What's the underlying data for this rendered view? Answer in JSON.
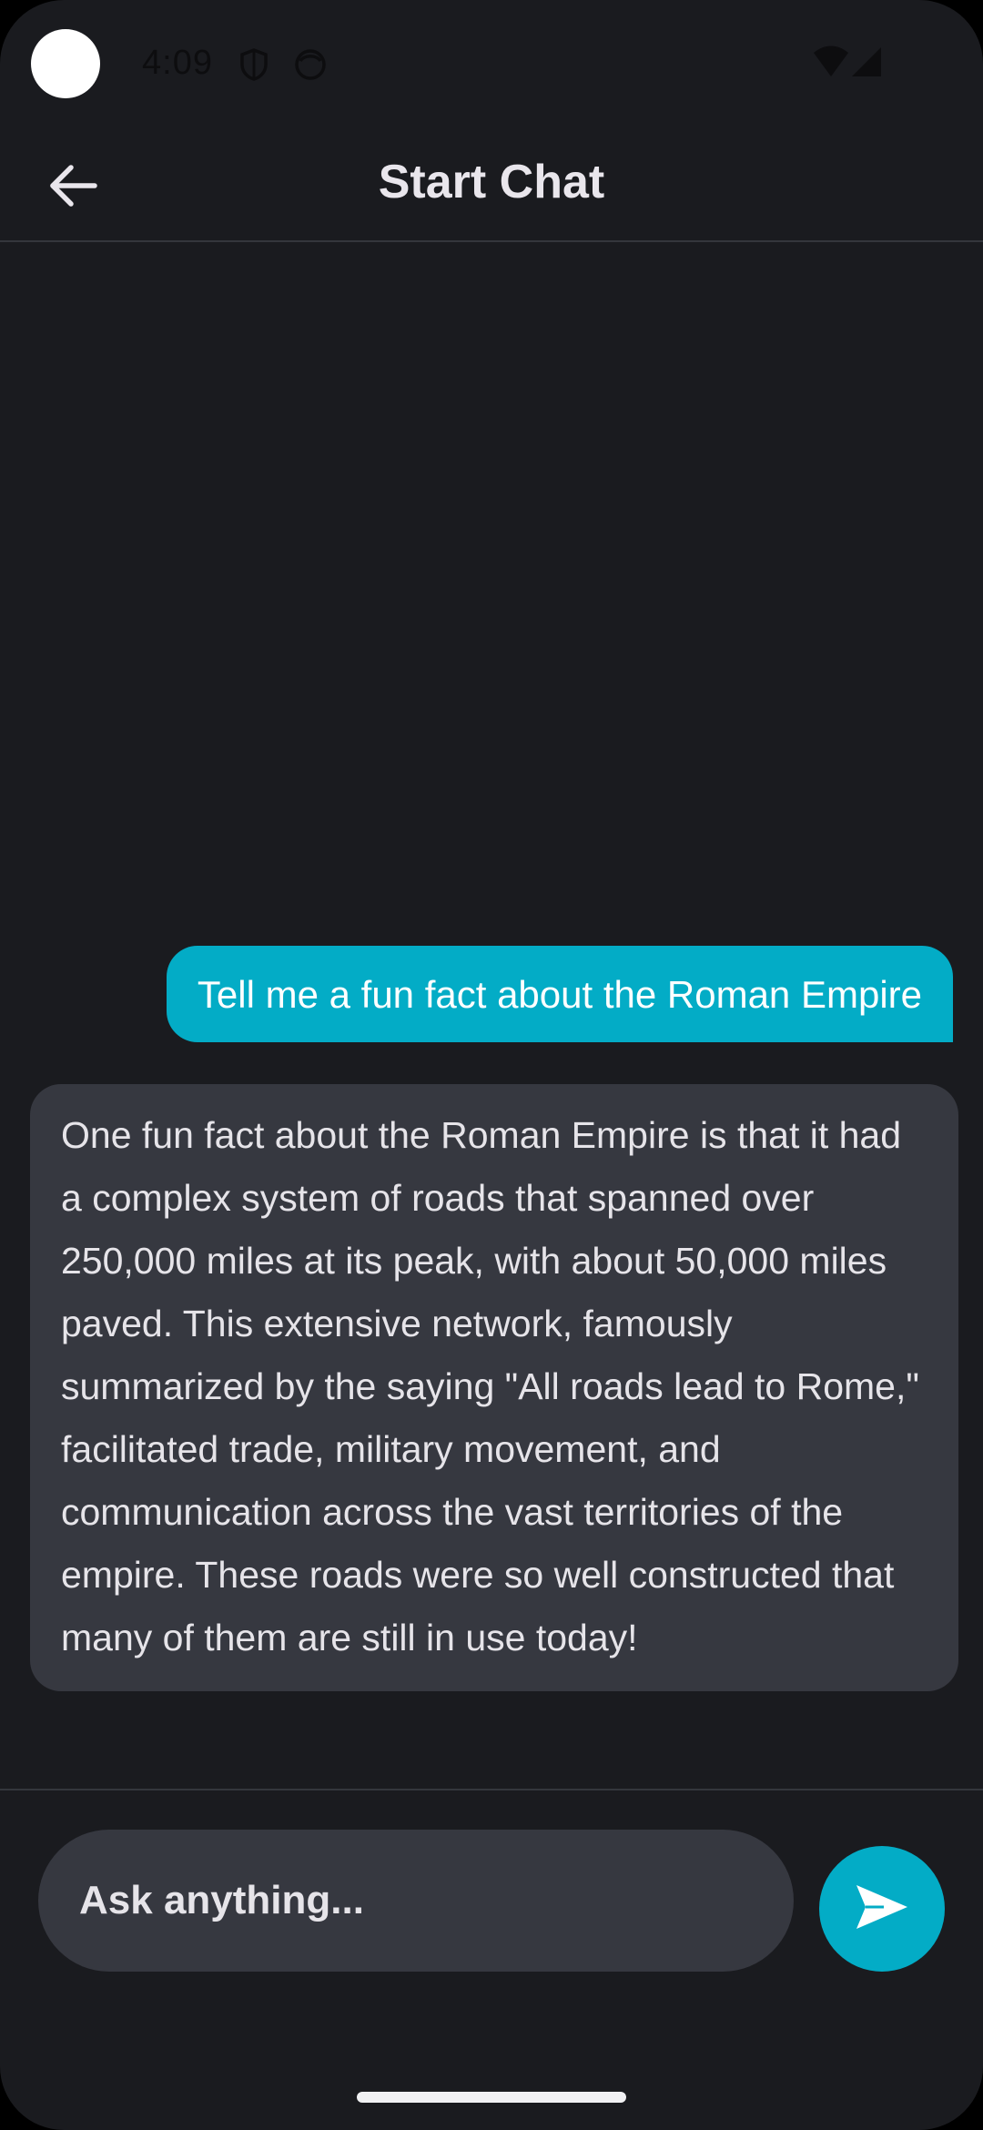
{
  "status_bar": {
    "time": "4:09",
    "icons": [
      "shield-icon",
      "face-icon",
      "wifi-icon",
      "cellular-signal-icon"
    ]
  },
  "header": {
    "back_icon": "arrow-left-icon",
    "title": "Start Chat"
  },
  "messages": [
    {
      "role": "user",
      "text": "Tell me a fun fact about the Roman Empire"
    },
    {
      "role": "assistant",
      "text": "One fun fact about the Roman Empire is that it had a complex system of roads that spanned over 250,000 miles at its peak, with about 50,000 miles paved. This extensive network, famously summarized by the saying \"All roads lead to Rome,\" facilitated trade, military movement, and communication across the vast territories of the empire. These roads were so well constructed that many of them are still in use today!"
    }
  ],
  "composer": {
    "placeholder": "Ask anything...",
    "send_icon": "send-icon"
  },
  "colors": {
    "background": "#1a1b1f",
    "accent": "#03acc6",
    "bubble_ai": "#363840",
    "text": "#e6e4e9"
  }
}
